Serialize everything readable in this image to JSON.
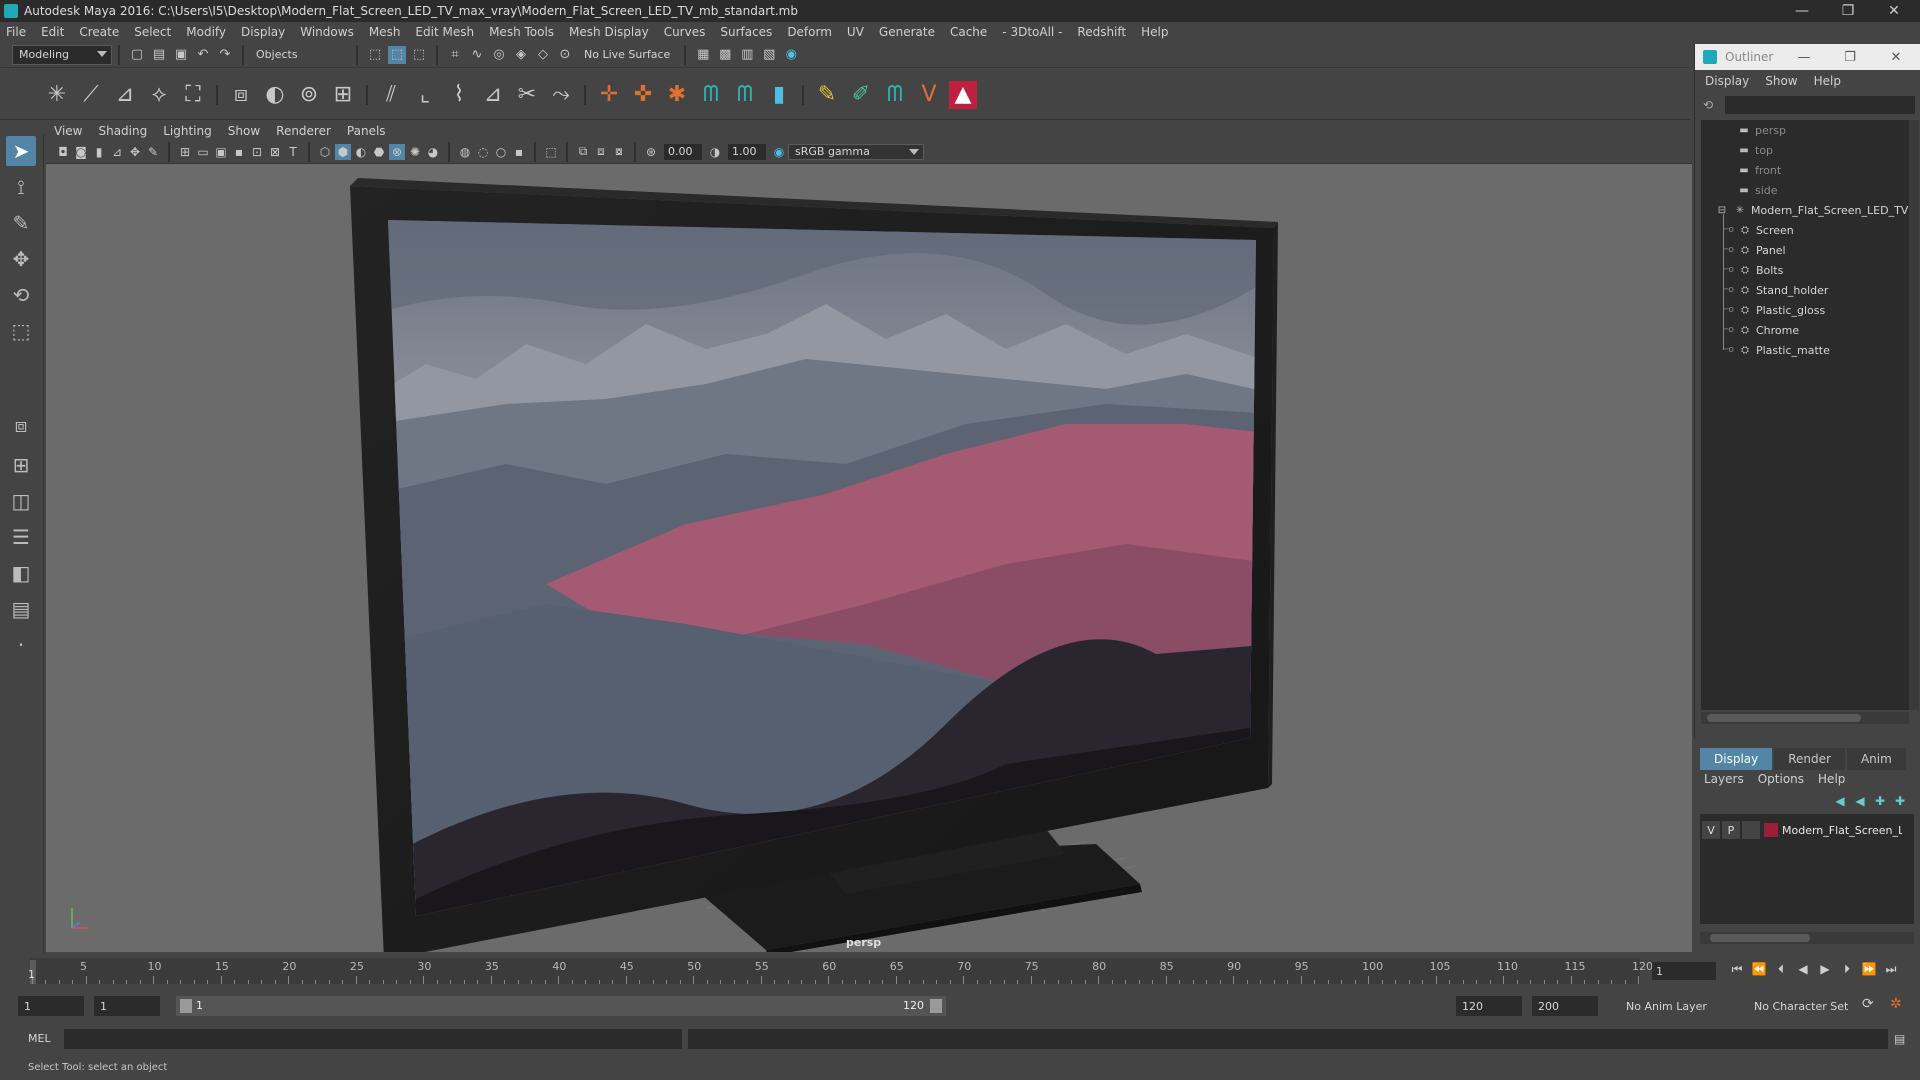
{
  "window": {
    "title": "Autodesk Maya 2016: C:\\Users\\I5\\Desktop\\Modern_Flat_Screen_LED_TV_max_vray\\Modern_Flat_Screen_LED_TV_mb_standart.mb",
    "minimize": "—",
    "maximize": "❐",
    "close": "✕"
  },
  "menu": [
    "File",
    "Edit",
    "Create",
    "Select",
    "Modify",
    "Display",
    "Windows",
    "Mesh",
    "Edit Mesh",
    "Mesh Tools",
    "Mesh Display",
    "Curves",
    "Surfaces",
    "Deform",
    "UV",
    "Generate",
    "Cache",
    "- 3DtoAll -",
    "Redshift",
    "Help"
  ],
  "status_line": {
    "mode": "Modeling",
    "select_mode": "Objects",
    "live_surface": "No Live Surface"
  },
  "panel": {
    "menu": [
      "View",
      "Shading",
      "Lighting",
      "Show",
      "Renderer",
      "Panels"
    ],
    "near_clip": "0.00",
    "exposure": "1.00",
    "color_space": "sRGB gamma",
    "camera_label": "persp"
  },
  "outliner": {
    "title": "Outliner",
    "menu": [
      "Display",
      "Show",
      "Help"
    ],
    "cameras": [
      "persp",
      "top",
      "front",
      "side"
    ],
    "root": "Modern_Flat_Screen_LED_TV",
    "children": [
      "Screen",
      "Panel",
      "Bolts",
      "Stand_holder",
      "Plastic_gloss",
      "Chrome",
      "Plastic_matte"
    ]
  },
  "layer_editor": {
    "tabs": [
      "Display",
      "Render",
      "Anim"
    ],
    "active_tab": "Display",
    "menu": [
      "Layers",
      "Options",
      "Help"
    ],
    "layer": {
      "v": "V",
      "p": "P",
      "name": "Modern_Flat_Screen_LED_TV",
      "color": "#9b1f3a"
    }
  },
  "timeline": {
    "ticks": [
      5,
      10,
      15,
      20,
      25,
      30,
      35,
      40,
      45,
      50,
      55,
      60,
      65,
      70,
      75,
      80,
      85,
      90,
      95,
      100,
      105,
      110,
      115,
      120
    ],
    "min": 1,
    "max": 120,
    "current": "1",
    "current_field": "1"
  },
  "range": {
    "start": "1",
    "playback_start": "1",
    "slider_start": "1",
    "slider_end": "120",
    "playback_end": "120",
    "end": "200",
    "anim_layer": "No Anim Layer",
    "character_set": "No Character Set"
  },
  "command_line": {
    "label": "MEL"
  },
  "help_line": {
    "text": "Select Tool: select an object"
  }
}
